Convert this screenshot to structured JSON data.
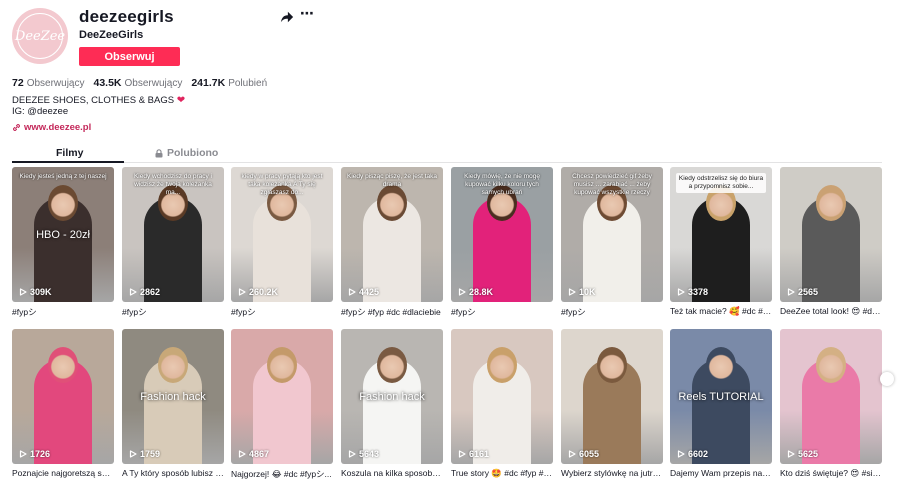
{
  "profile": {
    "avatar_text": "DeeZee",
    "username": "deezeegirls",
    "nickname": "DeeZeeGirls",
    "follow_label": "Obserwuj",
    "stats": [
      {
        "value": "72",
        "label": "Obserwujący"
      },
      {
        "value": "43.5K",
        "label": "Obserwujący"
      },
      {
        "value": "241.7K",
        "label": "Polubień"
      }
    ],
    "bio_line1": "DEEZEE SHOES, CLOTHES & BAGS",
    "bio_line2": "IG: @deezee",
    "link": "www.deezee.pl",
    "icons": {
      "share": "share-icon",
      "more": "more-icon",
      "link": "link-icon"
    }
  },
  "tabs": {
    "videos": "Filmy",
    "liked": "Polubiono"
  },
  "videos": [
    {
      "views": "309K",
      "caption": "#fypシ",
      "overlay": "Kiedy jesteś jedną z tej naszej",
      "center": "HBO - 20zł",
      "bg": "#8c7f78",
      "body": "#3b2f2d",
      "hair": "#6b4a32"
    },
    {
      "views": "2862",
      "caption": "#fypシ",
      "overlay": "Kiedy wchodzisz do pracy i widzisz że twoja koleżanka ma...",
      "center": "",
      "bg": "#c9c4c0",
      "body": "#2a2a2a",
      "hair": "#5a3a25"
    },
    {
      "views": "260.2K",
      "caption": "#fypシ",
      "overlay": "kiedy w pracy pytają kto jest taka koleżanka A Ty się zgłaszasz do...",
      "center": "",
      "bg": "#ddd8d3",
      "body": "#e8e1da",
      "hair": "#7a5a42"
    },
    {
      "views": "4425",
      "caption": "#fypシ #fyp #dc #dlaciebie",
      "overlay": "Kiedy pisząc piszę, że jest taka drama",
      "center": "",
      "bg": "#bdb6ae",
      "body": "#ece7e2",
      "hair": "#6a4a34"
    },
    {
      "views": "28.8K",
      "caption": "#fypシ",
      "overlay": "Kiedy mówię, że nie mogę kupować kilku koloru tych samych ubrań",
      "center": "",
      "bg": "#9aa0a3",
      "body": "#e2227a",
      "hair": "#4a2e20"
    },
    {
      "views": "10K",
      "caption": "#fypシ",
      "overlay": "Chcesz powiedzieć gif żeby musisz ... zarabiać ... żeby kupować wszystkie rzeczy",
      "center": "",
      "bg": "#b0aca8",
      "body": "#f1efea",
      "hair": "#6e4b33"
    },
    {
      "views": "3378",
      "caption": "Też tak macie? 🥰 #dc #d...",
      "overlay": "Kiedy odstrzelisz się do biura a przypomnisz sobie...",
      "overlay_dark": true,
      "center": "",
      "bg": "#d9d8d6",
      "body": "#1e1e1e",
      "hair": "#c9a26a"
    },
    {
      "views": "2565",
      "caption": "DeeZee total look! 😍 #dc...",
      "overlay": "",
      "center": "",
      "bg": "#cfccc6",
      "body": "#5a5a5a",
      "hair": "#caa173"
    },
    {
      "views": "1726",
      "caption": "Poznajcie najgoretszą suki...",
      "overlay": "",
      "center": "",
      "bg": "#b8a89a",
      "body": "#e2487d",
      "hair": "#e05078"
    },
    {
      "views": "1759",
      "caption": "A Ty który sposób lubisz n...",
      "overlay": "",
      "center": "Fashion hack",
      "bg": "#8f8a80",
      "body": "#d8cbb8",
      "hair": "#c8a878"
    },
    {
      "views": "4867",
      "caption": "Najgorzej! 😂 #dc #fypシ...",
      "overlay": "",
      "center": "",
      "bg": "#d9a9a9",
      "body": "#f1c7cf",
      "hair": "#c49a6a"
    },
    {
      "views": "5643",
      "caption": "Koszula na kilka sposobów...",
      "overlay": "",
      "center": "Fashion hack",
      "bg": "#b9b6b2",
      "body": "#f5f5f3",
      "hair": "#7a5a42"
    },
    {
      "views": "6161",
      "caption": "True story 🤩 #dc #fyp #v...",
      "overlay": "",
      "center": "",
      "bg": "#d8c8c0",
      "body": "#f0ede9",
      "hair": "#c9a06a"
    },
    {
      "views": "6055",
      "caption": "Wybierz stylówkę na jutro ...",
      "overlay": "",
      "center": "",
      "bg": "#ddd6cd",
      "body": "#9a7a5a",
      "hair": "#7b5a3e"
    },
    {
      "views": "6602",
      "caption": "Dajemy Wam przepis na fil...",
      "overlay": "",
      "center": "Reels TUTORIAL",
      "bg": "#7a8aa8",
      "body": "#3d4a60",
      "hair": "#3d4a60"
    },
    {
      "views": "5625",
      "caption": "Kto dziś świętuje? 😍 #sin...",
      "overlay": "",
      "center": "",
      "bg": "#e4c4cf",
      "body": "#ea7aa8",
      "hair": "#d4b084"
    }
  ],
  "icons": {
    "play": "play-icon",
    "lock": "lock-icon"
  },
  "colors": {
    "accent": "#fe2c55",
    "link": "#c4285a"
  }
}
